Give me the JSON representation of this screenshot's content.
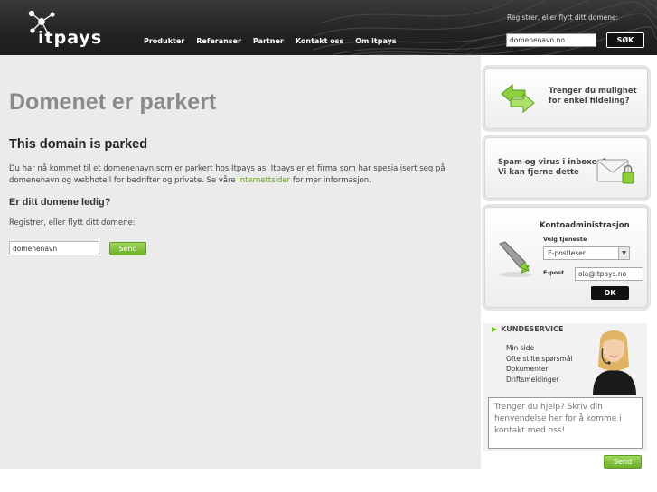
{
  "header": {
    "logo_text": "itpays",
    "nav": [
      "Produkter",
      "Referanser",
      "Partner",
      "Kontakt oss",
      "Om itpays"
    ],
    "register_label": "Registrer, eller flytt ditt domene:",
    "domain_value": "domenenavn.no",
    "search_label": "SØK"
  },
  "main": {
    "title": "Domenet er parkert",
    "subtitle": "This domain is parked",
    "intro_before": "Du har nå kommet til et domenenavn som er parkert hos Itpays as. Itpays er et firma som har spesialisert seg på domenenavn og webhotell for bedrifter og private. Se våre ",
    "intro_link": "internettsider",
    "intro_after": " for mer informasjon.",
    "question": "Er ditt domene ledig?",
    "register_label": "Registrer, eller flytt ditt domene:",
    "domain_value": "domenenavn",
    "send_label": "Send"
  },
  "sidebar": {
    "promo_share": "Trenger du mulighet\nfor enkel fildeling?",
    "promo_spam": "Spam og virus i inboxen?\nVi kan fjerne dette",
    "account": {
      "title": "Kontoadministrasjon",
      "service_label": "Velg tjeneste",
      "service_value": "E-postleser",
      "email_label": "E-post",
      "email_value": "ola@itpays.no",
      "ok_label": "OK"
    },
    "customer_service": {
      "title": "KUNDESERVICE",
      "links": [
        "Min side",
        "Ofte stilte spørsmål",
        "Dokumenter",
        "Driftsmeldinger"
      ],
      "message_placeholder": "Trenger du hjelp? Skriv din henvendelse her for å komme i kontakt med oss!",
      "send_label": "Send"
    }
  },
  "colors": {
    "header_bg": "#232323",
    "main_bg": "#ebebeb",
    "accent_green": "#7cbf2f",
    "title_gray": "#8a8a8a"
  }
}
